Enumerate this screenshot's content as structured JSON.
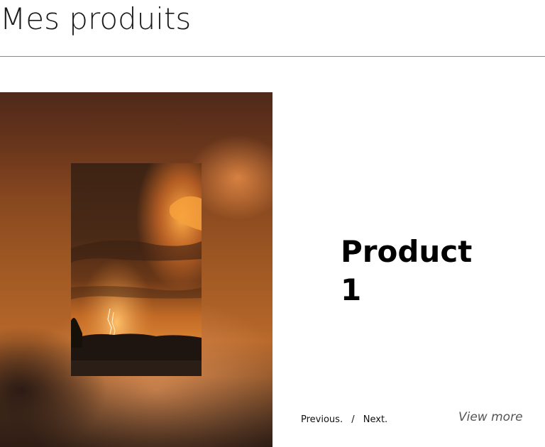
{
  "page": {
    "title": "Mes produits"
  },
  "product": {
    "name": "Product 1",
    "image_desc_icon": "storm-photo"
  },
  "navigation": {
    "previous_label": "Previous.",
    "separator": "/",
    "next_label": "Next."
  },
  "actions": {
    "view_more_label": "View more"
  },
  "colors": {
    "accent_orange": "#e08a3c",
    "dark_brown": "#3a2418",
    "rule": "#888888"
  }
}
